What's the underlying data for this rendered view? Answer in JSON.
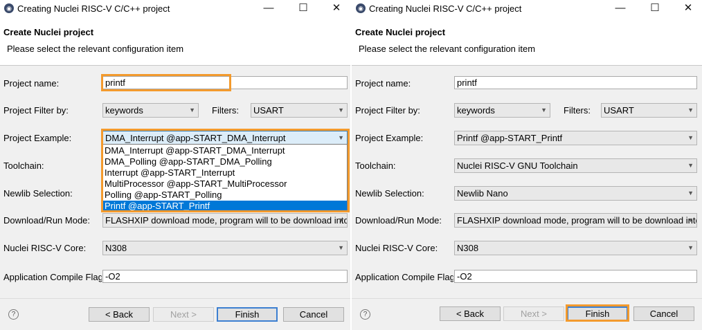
{
  "window": {
    "title": "Creating Nuclei RISC-V C/C++ project",
    "minimize": "—",
    "maximize": "☐",
    "close": "✕"
  },
  "header": {
    "title": "Create Nuclei project",
    "subtitle": "Please select the relevant configuration item"
  },
  "labels": {
    "project_name": "Project name:",
    "project_filter": "Project Filter by:",
    "filters": "Filters:",
    "project_example": "Project Example:",
    "toolchain": "Toolchain:",
    "newlib": "Newlib Selection:",
    "download_mode": "Download/Run Mode:",
    "core": "Nuclei RISC-V Core:",
    "compile_flags": "Application Compile Flags:"
  },
  "left": {
    "project_name": "printf",
    "filter_by": "keywords",
    "filters": "USART",
    "example": "DMA_Interrupt  @app-START_DMA_Interrupt",
    "download_mode": "FLASHXIP download mode, program will to be download into flash and run",
    "core": "N308",
    "compile_flags": "-O2",
    "dropdown_options": [
      "DMA_Interrupt  @app-START_DMA_Interrupt",
      "DMA_Polling  @app-START_DMA_Polling",
      "Interrupt  @app-START_Interrupt",
      "MultiProcessor  @app-START_MultiProcessor",
      "Polling  @app-START_Polling",
      "Printf  @app-START_Printf"
    ],
    "dropdown_selected": "Printf  @app-START_Printf"
  },
  "right": {
    "project_name": "printf",
    "filter_by": "keywords",
    "filters": "USART",
    "example": "Printf  @app-START_Printf",
    "toolchain": "Nuclei RISC-V GNU Toolchain",
    "newlib": "Newlib Nano",
    "download_mode": "FLASHXIP download mode, program will to be download into flash and run",
    "core": "N308",
    "compile_flags": "-O2"
  },
  "buttons": {
    "help": "?",
    "back": "< Back",
    "next": "Next >",
    "finish": "Finish",
    "cancel": "Cancel"
  },
  "colors": {
    "highlight": "#f39a2d",
    "selection": "#0078d7",
    "default_button_border": "#3c7fd1"
  },
  "icons": {
    "app": "eclipse-icon",
    "dropdown": "chevron-down-icon",
    "help": "help-icon"
  }
}
